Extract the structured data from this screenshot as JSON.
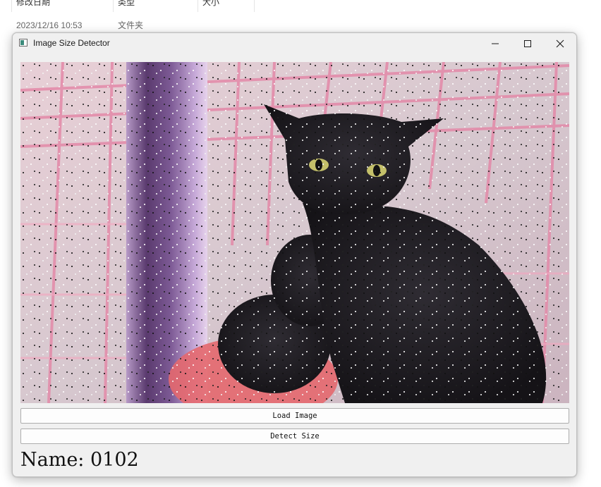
{
  "explorer": {
    "columns": [
      "修改日期",
      "类型",
      "大小"
    ],
    "row": {
      "modified": "2023/12/16 10:53",
      "type": "文件夹"
    }
  },
  "window": {
    "title": "Image Size Detector",
    "icon": "app-window-icon",
    "controls": [
      "minimize-icon",
      "maximize-icon",
      "close-icon"
    ]
  },
  "main": {
    "image_description_icon": "cat-photo",
    "buttons": {
      "load_image": "Load Image",
      "detect_size": "Detect Size"
    },
    "name_label": "Name: 0102"
  },
  "colors": {
    "window_bg": "#f0f0f0",
    "button_border": "#adadad"
  }
}
